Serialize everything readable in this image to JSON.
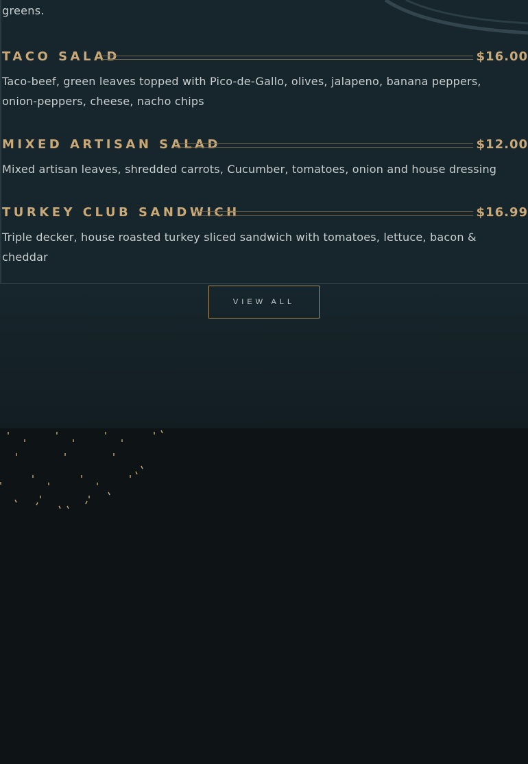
{
  "intro_tail": "greens.",
  "menu_items": [
    {
      "name": "TACO SALAD",
      "price": "$16.00",
      "description": "Taco-beef, green leaves topped with Pico-de-Gallo, olives, jalapeno, banana peppers, onion-peppers, cheese, nacho chips"
    },
    {
      "name": "MIXED ARTISAN SALAD",
      "price": "$12.00",
      "description": "Mixed artisan leaves, shredded carrots, Cucumber, tomatoes, onion and house dressing"
    },
    {
      "name": "TURKEY CLUB SANDWICH",
      "price": "$16.99",
      "description": "Triple decker, house roasted turkey sliced sandwich with tomatoes, lettuce, bacon & cheddar"
    }
  ],
  "view_all_label": "VIEW ALL",
  "colors": {
    "panel": "#17262d",
    "page": "#0e1416",
    "gold": "#c9a978",
    "text": "#c9cfd1"
  }
}
